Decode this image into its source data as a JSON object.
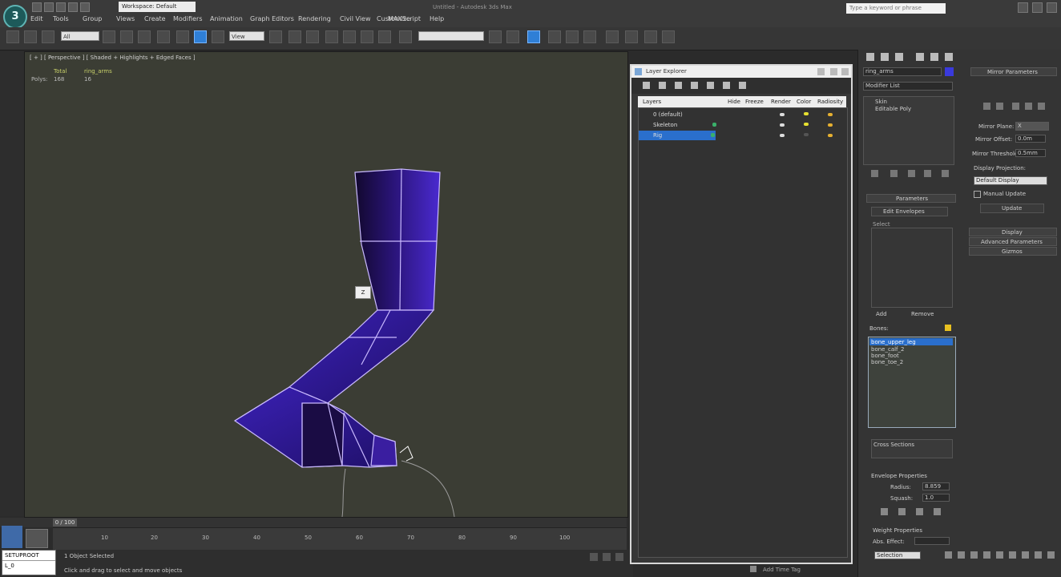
{
  "app": {
    "logo": "3",
    "window_title": "Untitled - Autodesk 3ds Max"
  },
  "workspace": {
    "label": "Workspace: Default"
  },
  "help_search": {
    "placeholder": "Type a keyword or phrase"
  },
  "menu": [
    "Edit",
    "Tools",
    "Group",
    "Views",
    "Create",
    "Modifiers",
    "Animation",
    "Graph Editors",
    "Rendering",
    "Civil View",
    "Customize",
    "MAXScript",
    "Help"
  ],
  "toolbar": {
    "filter_label": "All",
    "ref_coord": "View",
    "named_sel": ""
  },
  "viewport": {
    "label": "[ + ] [ Perspective ] [ Shaded + Highlights + Edged Faces ]",
    "stat_heading_1": "Total",
    "stat_heading_2": "ring_arms",
    "stat_row_label": "Polys:",
    "stat_1": "168",
    "stat_2": "16",
    "gizmo_label": "Z"
  },
  "timeline": {
    "frame_counter": "0 / 100",
    "ticks": [
      "10",
      "20",
      "30",
      "40",
      "50",
      "60",
      "70",
      "80",
      "90",
      "100"
    ]
  },
  "status": {
    "maxscript_line1": "SETUPROOT",
    "maxscript_line2": "L_0",
    "prompt": "1 Object Selected",
    "hint": "Click and drag to select and move objects",
    "add_time_tag": "Add Time Tag"
  },
  "layer_explorer": {
    "title": "Layer Explorer",
    "columns": [
      "Layers",
      "Hide",
      "Freeze",
      "Render",
      "Color",
      "Radiosity"
    ],
    "rows": [
      {
        "name": "0 (default)",
        "selected": false
      },
      {
        "name": "Skeleton",
        "selected": false
      },
      {
        "name": "Rig",
        "selected": true
      }
    ]
  },
  "command_panel": {
    "name_field": "ring_arms",
    "modifier_list": "Modifier List",
    "stack_items": [
      "Skin",
      "Editable Poly"
    ],
    "parameters_title": "Parameters",
    "edit_envelopes": "Edit Envelopes",
    "select_label": "Select",
    "bones_label": "Bones:",
    "add_label": "Add",
    "remove_label": "Remove",
    "bones": [
      "bone_upper_leg",
      "bone_calf_2",
      "bone_foot",
      "bone_toe_2"
    ],
    "cross_sections": "Cross Sections",
    "envelope_properties": "Envelope Properties",
    "radius_label": "Radius:",
    "radius_value": "8.859",
    "squash_label": "Squash:",
    "squash_value": "1.0",
    "weight_properties": "Weight Properties",
    "abs_effect": "Abs. Effect:"
  },
  "mirror_panel": {
    "title": "Mirror Parameters",
    "mirror_plane_label": "Mirror Plane:",
    "mirror_plane_value": "X",
    "mirror_offset_label": "Mirror Offset:",
    "mirror_offset_value": "0.0m",
    "mirror_threshold_label": "Mirror Threshold:",
    "mirror_threshold_value": "0.5mm",
    "display_projection": "Display Projection:",
    "display_projection_value": "Default Display",
    "manual_update": "Manual Update",
    "update": "Update",
    "display": "Display",
    "advanced_parameters": "Advanced Parameters",
    "gizmos": "Gizmos"
  },
  "selection_filter": "Selection",
  "colors": {
    "accent_blue": "#2a6fcc",
    "viewport_bg": "#3b3d34",
    "mesh_fill": "#3a1ea0",
    "mesh_edge": "#c9b9ff"
  }
}
